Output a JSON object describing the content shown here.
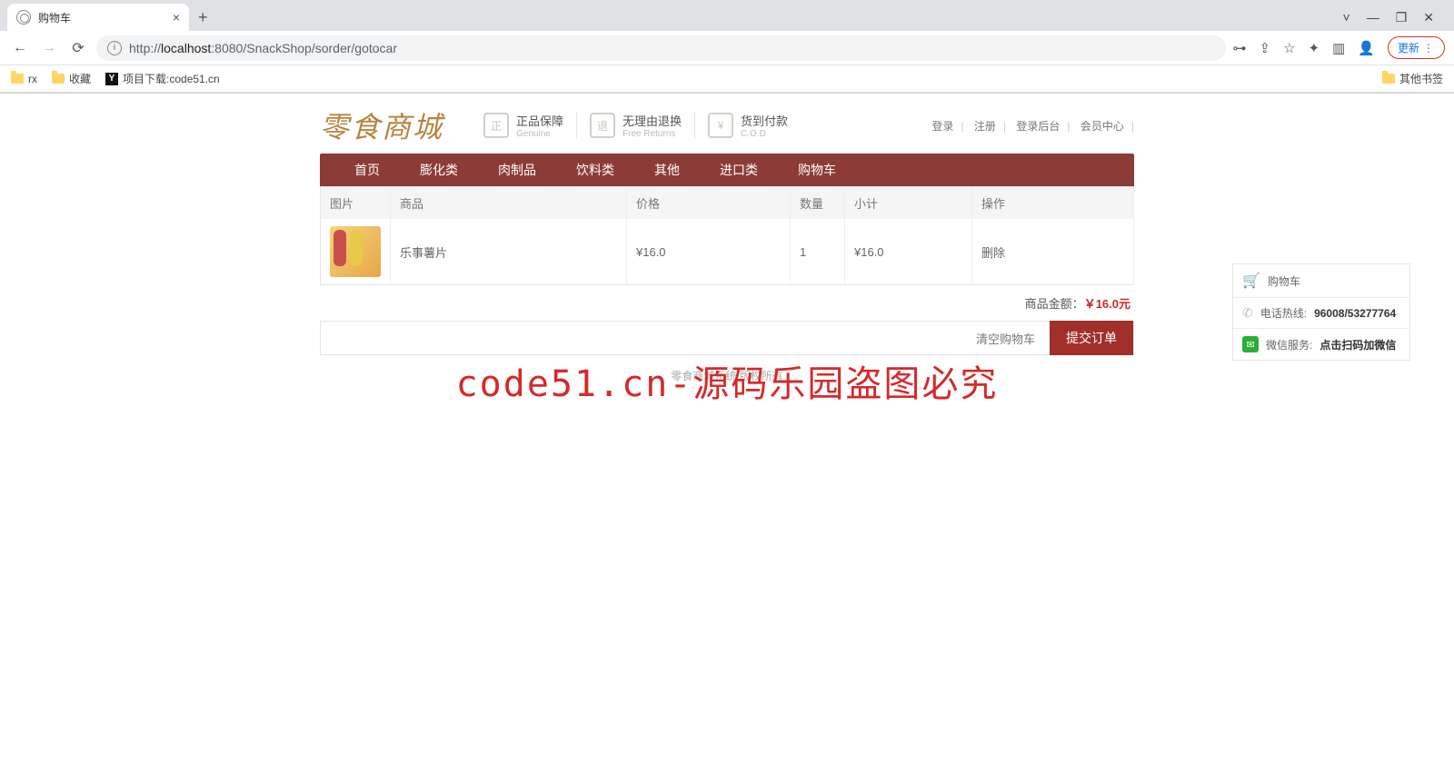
{
  "browser": {
    "tab_title": "购物车",
    "url_prefix": "http://",
    "url_host": "localhost",
    "url_port": ":8080",
    "url_path": "/SnackShop/sorder/gotocar",
    "update_label": "更新",
    "bookmarks": {
      "b1": "rx",
      "b2": "收藏",
      "b3": "项目下载:code51.cn",
      "other": "其他书签"
    }
  },
  "site": {
    "logo": "零食商城",
    "badges": [
      {
        "title": "正品保障",
        "sub": "Genuine",
        "icon": "正"
      },
      {
        "title": "无理由退换",
        "sub": "Free Returns",
        "icon": "退"
      },
      {
        "title": "货到付款",
        "sub": "C.O.D",
        "icon": "¥"
      }
    ],
    "top_links": [
      "登录",
      "注册",
      "登录后台",
      "会员中心"
    ],
    "nav": [
      "首页",
      "膨化类",
      "肉制品",
      "饮料类",
      "其他",
      "进口类",
      "购物车"
    ]
  },
  "table": {
    "headers": {
      "img": "图片",
      "name": "商品",
      "price": "价格",
      "qty": "数量",
      "sub": "小计",
      "op": "操作"
    },
    "rows": [
      {
        "name": "乐事薯片",
        "price": "¥16.0",
        "qty": "1",
        "sub": "¥16.0",
        "op": "删除"
      }
    ]
  },
  "summary": {
    "label": "商品金额：",
    "amount": "￥16.0元"
  },
  "actions": {
    "clear": "清空购物车",
    "submit": "提交订单"
  },
  "footer": "零食商城系统 版权所有",
  "side": {
    "cart": "购物车",
    "hotline_label": "电话热线:",
    "hotline": "96008/53277764",
    "wechat_label": "微信服务:",
    "wechat": "点击扫码加微信"
  },
  "watermark": "code51.cn-源码乐园盗图必究"
}
